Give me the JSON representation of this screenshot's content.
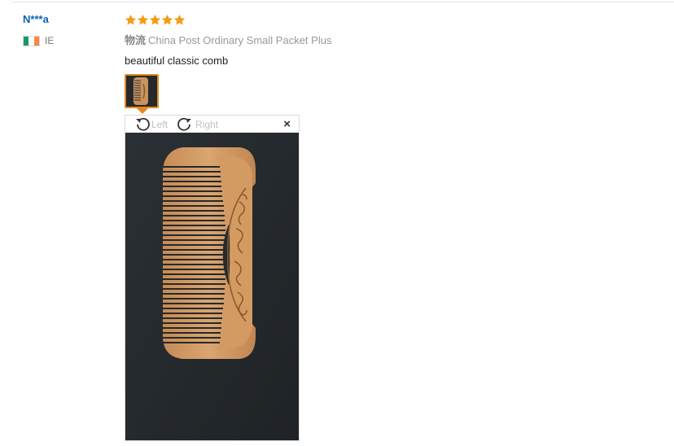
{
  "reviewer": {
    "name": "N***a",
    "country_code": "IE",
    "flag_colors": [
      "#169b62",
      "#ffffff",
      "#ff883e"
    ]
  },
  "review": {
    "rating": 5,
    "rating_max": 5,
    "star_color": "#f39c12",
    "shipping_label": "物流",
    "shipping_method": "China Post Ordinary Small Packet Plus",
    "text": "beautiful classic comb"
  },
  "image_viewer": {
    "rotate_left_label": "Left",
    "rotate_right_label": "Right",
    "close_glyph": "×",
    "rotate_left_icon": "rotate-left-icon",
    "rotate_right_icon": "rotate-right-icon",
    "photo_subject": "wooden-comb",
    "accent_color": "#e08a1e"
  }
}
